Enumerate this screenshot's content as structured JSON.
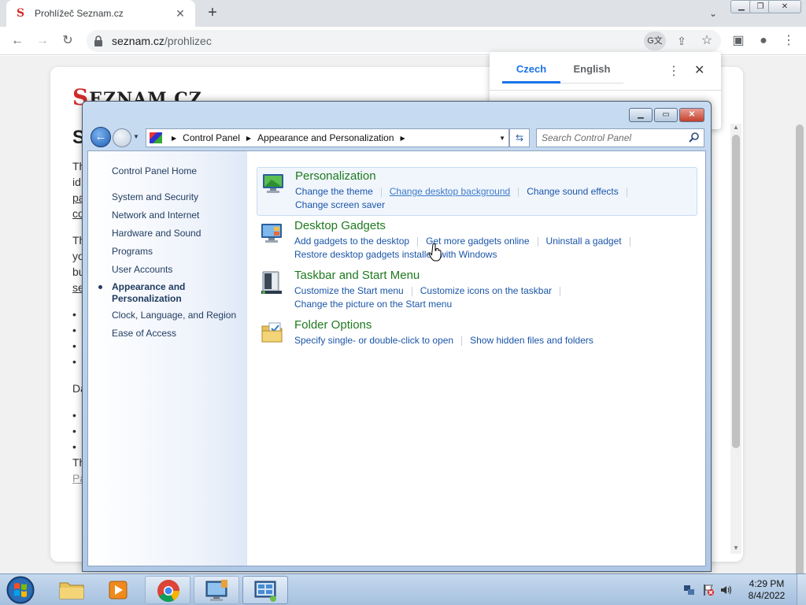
{
  "browser": {
    "tab_title": "Prohlížeč Seznam.cz",
    "tab_favicon": "S",
    "url_host": "seznam.cz",
    "url_path": "/prohlizec"
  },
  "page": {
    "logo_initial": "S",
    "logo_rest": "EZNAM.CZ",
    "heading": "S",
    "fragments": [
      "Th",
      "id",
      "pa",
      "co",
      "Th",
      "yo",
      "bu",
      "se",
      "Da",
      "Th",
      "Pa"
    ]
  },
  "translate": {
    "lang_source": "Czech",
    "lang_target": "English"
  },
  "control_panel": {
    "address": [
      "Control Panel",
      "Appearance and Personalization"
    ],
    "search_placeholder": "Search Control Panel",
    "nav": {
      "home": "Control Panel Home",
      "items": [
        "System and Security",
        "Network and Internet",
        "Hardware and Sound",
        "Programs",
        "User Accounts"
      ],
      "active_line1": "Appearance and",
      "active_line2": "Personalization",
      "items_after": [
        "Clock, Language, and Region",
        "Ease of Access"
      ]
    },
    "categories": [
      {
        "title": "Personalization",
        "links": [
          "Change the theme",
          "Change desktop background",
          "Change sound effects",
          "Change screen saver"
        ]
      },
      {
        "title": "Desktop Gadgets",
        "links": [
          "Add gadgets to the desktop",
          "Get more gadgets online",
          "Uninstall a gadget",
          "Restore desktop gadgets installed with Windows"
        ]
      },
      {
        "title": "Taskbar and Start Menu",
        "links": [
          "Customize the Start menu",
          "Customize icons on the taskbar",
          "Change the picture on the Start menu"
        ]
      },
      {
        "title": "Folder Options",
        "links": [
          "Specify single- or double-click to open",
          "Show hidden files and folders"
        ]
      }
    ]
  },
  "taskbar": {
    "time": "4:29 PM",
    "date": "8/4/2022"
  },
  "colors": {
    "category_title": "#1e7a1e",
    "link": "#1b55a8",
    "accent_blue": "#1a73e8"
  }
}
